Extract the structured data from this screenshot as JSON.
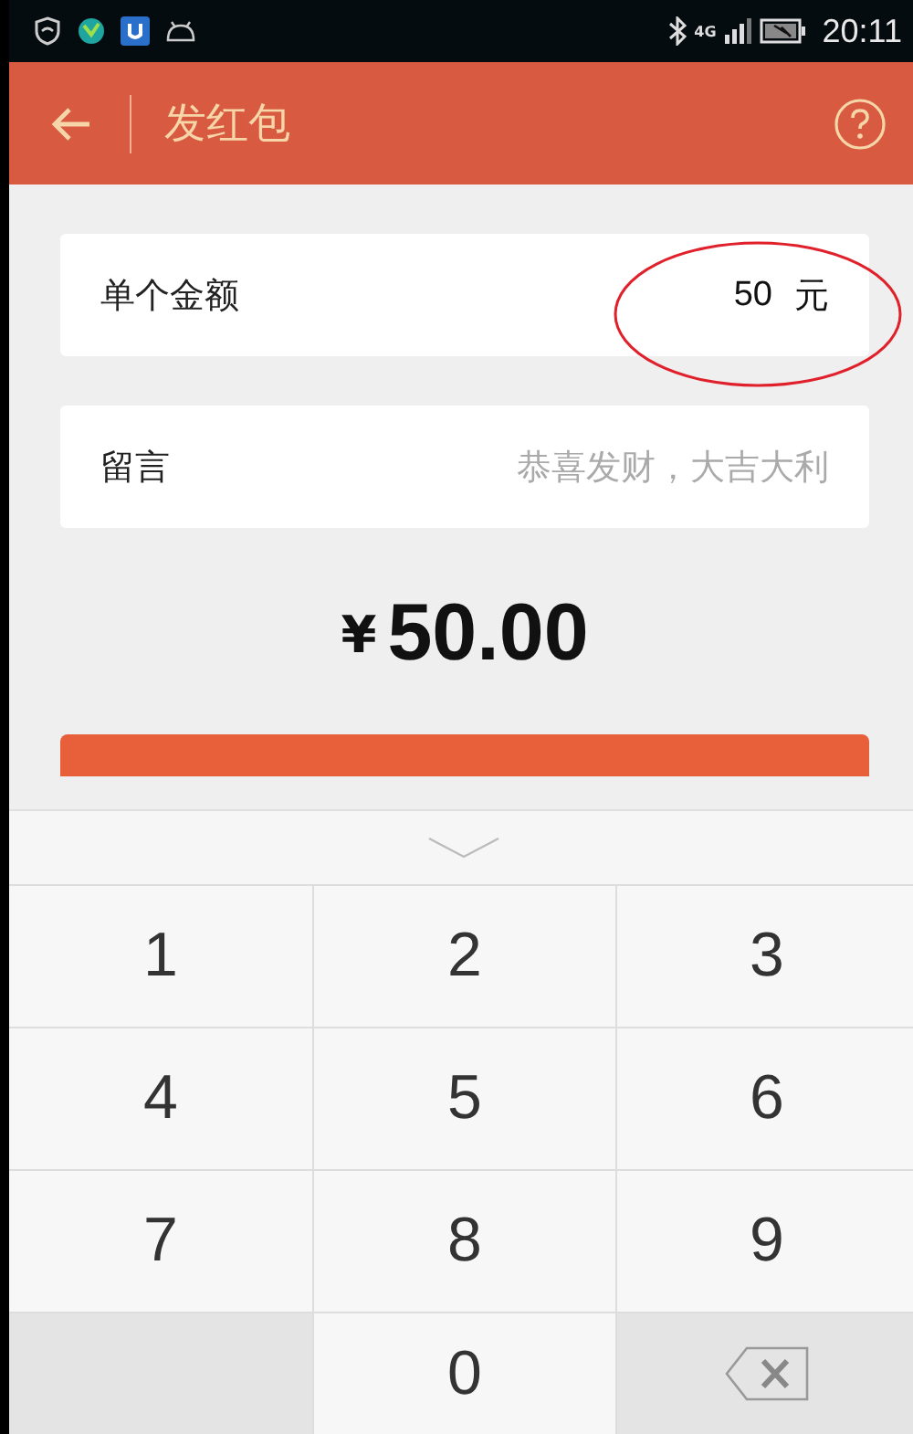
{
  "status_bar": {
    "network": "4G",
    "time": "20:11"
  },
  "header": {
    "title": "发红包"
  },
  "form": [
    {
      "label": "单个金额",
      "value": "50",
      "unit": "元",
      "kind": "amount"
    },
    {
      "label": "留言",
      "placeholder": "恭喜发财，大吉大利",
      "kind": "message"
    }
  ],
  "total": {
    "currency": "¥",
    "amount": "50.00"
  },
  "keypad": {
    "keys": [
      {
        "label": "1",
        "kind": "digit"
      },
      {
        "label": "2",
        "kind": "digit"
      },
      {
        "label": "3",
        "kind": "digit"
      },
      {
        "label": "4",
        "kind": "digit"
      },
      {
        "label": "5",
        "kind": "digit"
      },
      {
        "label": "6",
        "kind": "digit"
      },
      {
        "label": "7",
        "kind": "digit"
      },
      {
        "label": "8",
        "kind": "digit"
      },
      {
        "label": "9",
        "kind": "digit"
      },
      {
        "kind": "blank"
      },
      {
        "label": "0",
        "kind": "digit"
      },
      {
        "kind": "delete"
      }
    ]
  }
}
